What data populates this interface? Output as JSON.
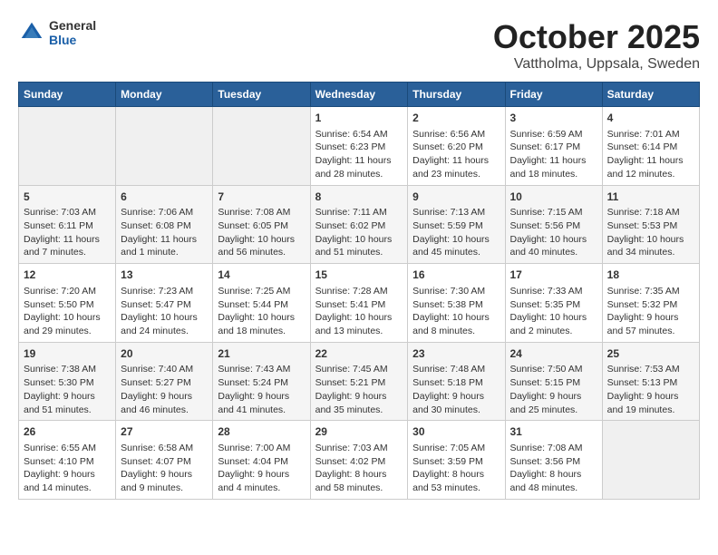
{
  "header": {
    "logo_general": "General",
    "logo_blue": "Blue",
    "month": "October 2025",
    "location": "Vattholma, Uppsala, Sweden"
  },
  "weekdays": [
    "Sunday",
    "Monday",
    "Tuesday",
    "Wednesday",
    "Thursday",
    "Friday",
    "Saturday"
  ],
  "weeks": [
    [
      {
        "day": "",
        "info": ""
      },
      {
        "day": "",
        "info": ""
      },
      {
        "day": "",
        "info": ""
      },
      {
        "day": "1",
        "info": "Sunrise: 6:54 AM\nSunset: 6:23 PM\nDaylight: 11 hours and 28 minutes."
      },
      {
        "day": "2",
        "info": "Sunrise: 6:56 AM\nSunset: 6:20 PM\nDaylight: 11 hours and 23 minutes."
      },
      {
        "day": "3",
        "info": "Sunrise: 6:59 AM\nSunset: 6:17 PM\nDaylight: 11 hours and 18 minutes."
      },
      {
        "day": "4",
        "info": "Sunrise: 7:01 AM\nSunset: 6:14 PM\nDaylight: 11 hours and 12 minutes."
      }
    ],
    [
      {
        "day": "5",
        "info": "Sunrise: 7:03 AM\nSunset: 6:11 PM\nDaylight: 11 hours and 7 minutes."
      },
      {
        "day": "6",
        "info": "Sunrise: 7:06 AM\nSunset: 6:08 PM\nDaylight: 11 hours and 1 minute."
      },
      {
        "day": "7",
        "info": "Sunrise: 7:08 AM\nSunset: 6:05 PM\nDaylight: 10 hours and 56 minutes."
      },
      {
        "day": "8",
        "info": "Sunrise: 7:11 AM\nSunset: 6:02 PM\nDaylight: 10 hours and 51 minutes."
      },
      {
        "day": "9",
        "info": "Sunrise: 7:13 AM\nSunset: 5:59 PM\nDaylight: 10 hours and 45 minutes."
      },
      {
        "day": "10",
        "info": "Sunrise: 7:15 AM\nSunset: 5:56 PM\nDaylight: 10 hours and 40 minutes."
      },
      {
        "day": "11",
        "info": "Sunrise: 7:18 AM\nSunset: 5:53 PM\nDaylight: 10 hours and 34 minutes."
      }
    ],
    [
      {
        "day": "12",
        "info": "Sunrise: 7:20 AM\nSunset: 5:50 PM\nDaylight: 10 hours and 29 minutes."
      },
      {
        "day": "13",
        "info": "Sunrise: 7:23 AM\nSunset: 5:47 PM\nDaylight: 10 hours and 24 minutes."
      },
      {
        "day": "14",
        "info": "Sunrise: 7:25 AM\nSunset: 5:44 PM\nDaylight: 10 hours and 18 minutes."
      },
      {
        "day": "15",
        "info": "Sunrise: 7:28 AM\nSunset: 5:41 PM\nDaylight: 10 hours and 13 minutes."
      },
      {
        "day": "16",
        "info": "Sunrise: 7:30 AM\nSunset: 5:38 PM\nDaylight: 10 hours and 8 minutes."
      },
      {
        "day": "17",
        "info": "Sunrise: 7:33 AM\nSunset: 5:35 PM\nDaylight: 10 hours and 2 minutes."
      },
      {
        "day": "18",
        "info": "Sunrise: 7:35 AM\nSunset: 5:32 PM\nDaylight: 9 hours and 57 minutes."
      }
    ],
    [
      {
        "day": "19",
        "info": "Sunrise: 7:38 AM\nSunset: 5:30 PM\nDaylight: 9 hours and 51 minutes."
      },
      {
        "day": "20",
        "info": "Sunrise: 7:40 AM\nSunset: 5:27 PM\nDaylight: 9 hours and 46 minutes."
      },
      {
        "day": "21",
        "info": "Sunrise: 7:43 AM\nSunset: 5:24 PM\nDaylight: 9 hours and 41 minutes."
      },
      {
        "day": "22",
        "info": "Sunrise: 7:45 AM\nSunset: 5:21 PM\nDaylight: 9 hours and 35 minutes."
      },
      {
        "day": "23",
        "info": "Sunrise: 7:48 AM\nSunset: 5:18 PM\nDaylight: 9 hours and 30 minutes."
      },
      {
        "day": "24",
        "info": "Sunrise: 7:50 AM\nSunset: 5:15 PM\nDaylight: 9 hours and 25 minutes."
      },
      {
        "day": "25",
        "info": "Sunrise: 7:53 AM\nSunset: 5:13 PM\nDaylight: 9 hours and 19 minutes."
      }
    ],
    [
      {
        "day": "26",
        "info": "Sunrise: 6:55 AM\nSunset: 4:10 PM\nDaylight: 9 hours and 14 minutes."
      },
      {
        "day": "27",
        "info": "Sunrise: 6:58 AM\nSunset: 4:07 PM\nDaylight: 9 hours and 9 minutes."
      },
      {
        "day": "28",
        "info": "Sunrise: 7:00 AM\nSunset: 4:04 PM\nDaylight: 9 hours and 4 minutes."
      },
      {
        "day": "29",
        "info": "Sunrise: 7:03 AM\nSunset: 4:02 PM\nDaylight: 8 hours and 58 minutes."
      },
      {
        "day": "30",
        "info": "Sunrise: 7:05 AM\nSunset: 3:59 PM\nDaylight: 8 hours and 53 minutes."
      },
      {
        "day": "31",
        "info": "Sunrise: 7:08 AM\nSunset: 3:56 PM\nDaylight: 8 hours and 48 minutes."
      },
      {
        "day": "",
        "info": ""
      }
    ]
  ]
}
